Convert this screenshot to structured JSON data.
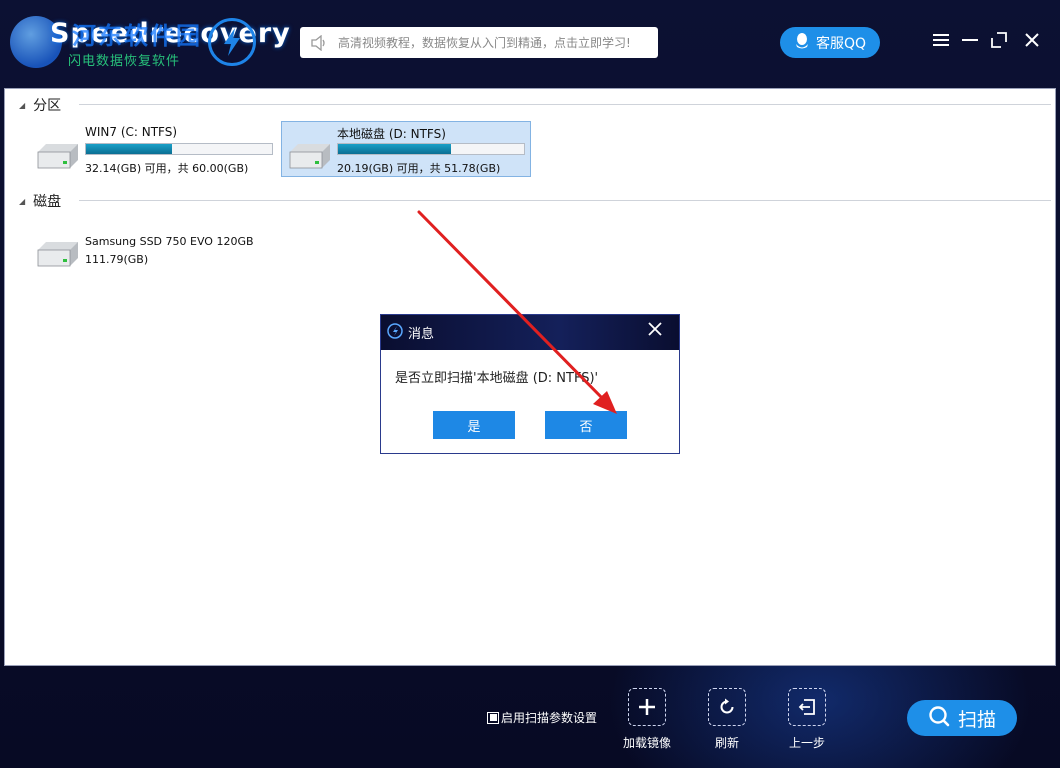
{
  "app": {
    "logo_name": "Speedrecovery",
    "logo_watermark": "河东软件园",
    "logo_subtitle": "闪电数据恢复软件",
    "notice_text": "高清视频教程，数据恢复从入门到精通，点击立即学习!",
    "qq_label": "客服QQ"
  },
  "sections": {
    "partition_title": "分区",
    "disk_title": "磁盘"
  },
  "partitions": [
    {
      "name": "WIN7 (C: NTFS)",
      "info": "32.14(GB) 可用，共 60.00(GB)",
      "used_fraction": 0.46,
      "selected": false
    },
    {
      "name": "本地磁盘 (D: NTFS)",
      "info": "20.19(GB) 可用，共 51.78(GB)",
      "used_fraction": 0.61,
      "selected": true
    }
  ],
  "disks": [
    {
      "name": "Samsung SSD 750 EVO 120GB",
      "info": "111.79(GB)"
    }
  ],
  "dialog": {
    "title": "消息",
    "message": "是否立即扫描'本地磁盘 (D: NTFS)'",
    "yes_label": "是",
    "no_label": "否"
  },
  "bottom": {
    "scan_params_label": "启用扫描参数设置",
    "scan_params_checked": true,
    "load_image_label": "加载镜像",
    "refresh_label": "刷新",
    "back_label": "上一步",
    "scan_label": "扫描"
  },
  "colors": {
    "accent": "#1e8fe8",
    "background": "#0b0f2e",
    "annotation_arrow": "#e02020"
  }
}
